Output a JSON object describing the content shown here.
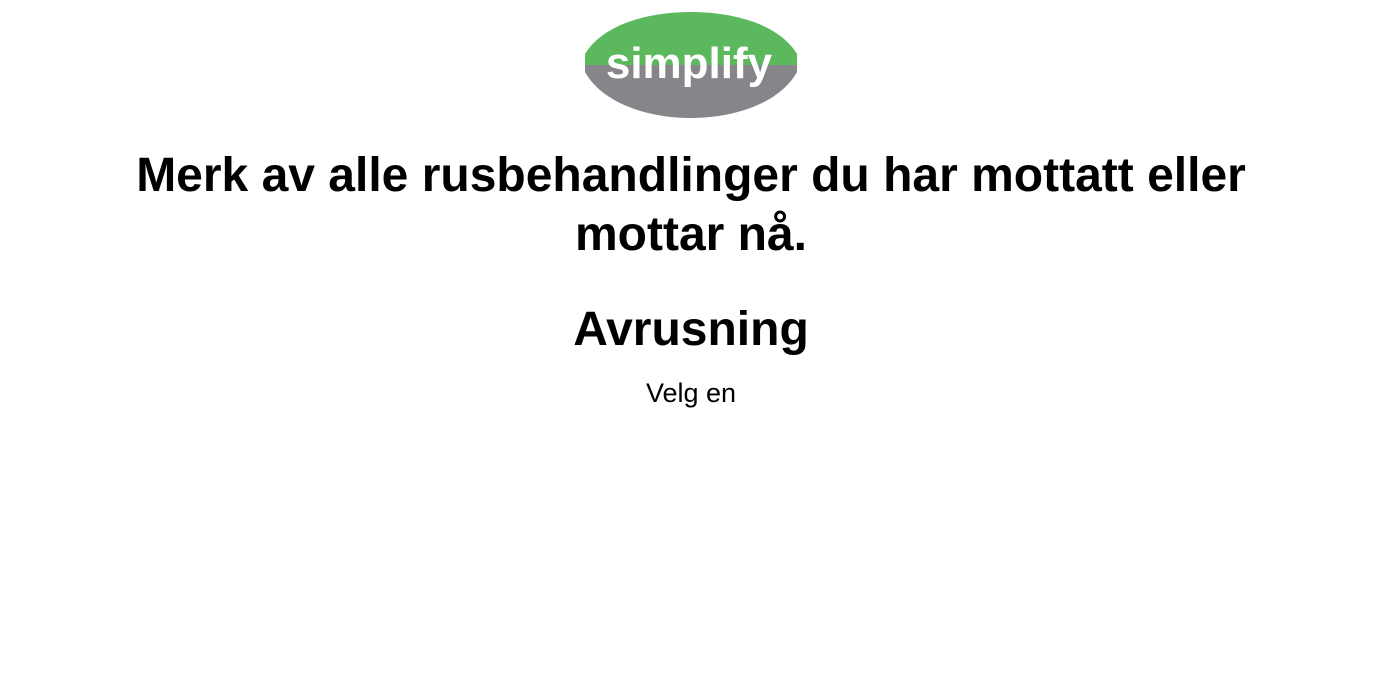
{
  "logo": {
    "text": "simplify",
    "colors": {
      "top": "#5cb85c",
      "bottom": "#86868a",
      "text": "#ffffff"
    }
  },
  "question": {
    "line1": "Merk av alle rusbehandlinger du har mottatt eller",
    "line2": "mottar nå."
  },
  "section": {
    "heading": "Avrusning",
    "instruction": "Velg en"
  }
}
